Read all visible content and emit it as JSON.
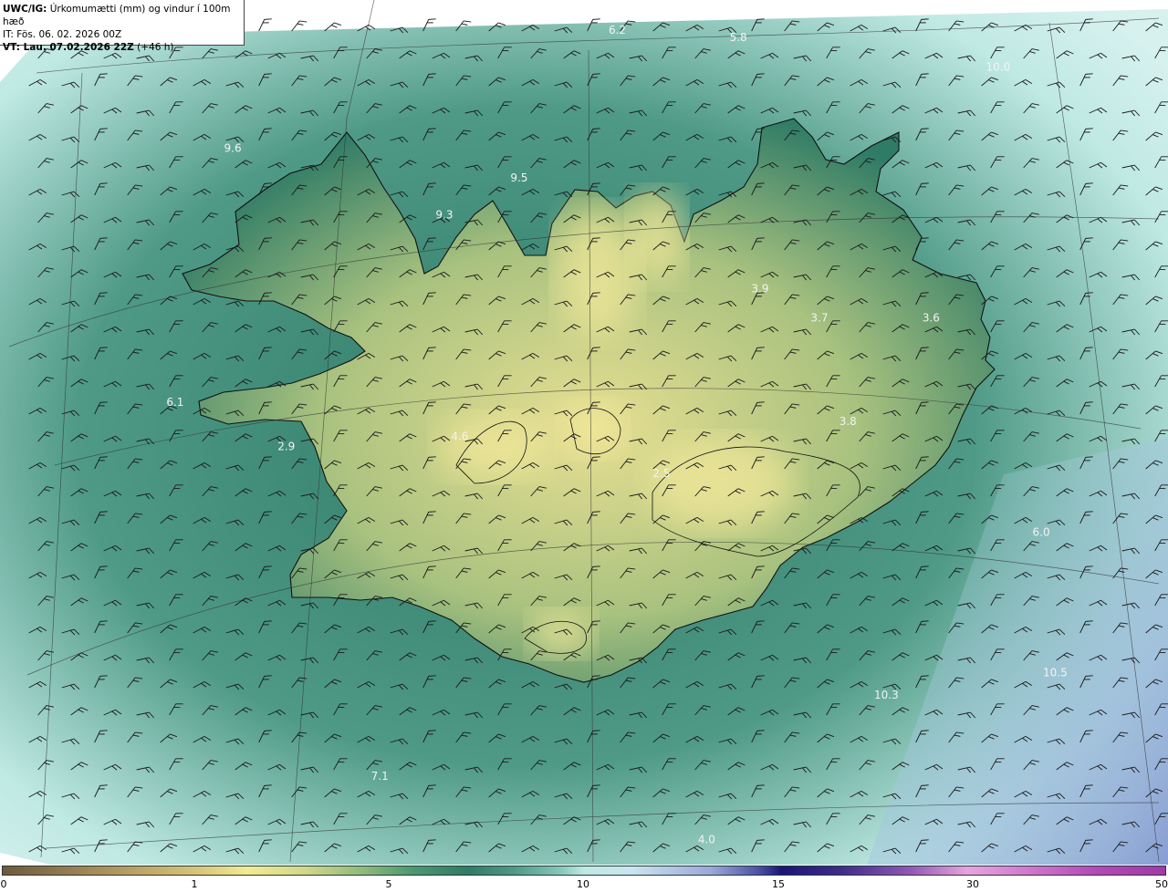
{
  "header": {
    "model_bold": "UWC/IG:",
    "title_rest": " Úrkomumætti (mm) og vindur í 100m hæð",
    "issue_time": "IT: Fös. 06. 02. 2026 00Z",
    "valid_time": "VT: Lau. 07.02.2026 22Z",
    "lead_time": " (+46 h)"
  },
  "map_labels": [
    {
      "text": "6.2",
      "lon": -18.05,
      "lat": 67.6
    },
    {
      "text": "5.8",
      "lon": -15.8,
      "lat": 67.55
    },
    {
      "text": "10.0",
      "lon": -11.0,
      "lat": 67.35
    },
    {
      "text": "9.6",
      "lon": -25.1,
      "lat": 66.8
    },
    {
      "text": "9.5",
      "lon": -19.85,
      "lat": 66.6
    },
    {
      "text": "9.3",
      "lon": -21.2,
      "lat": 66.35
    },
    {
      "text": "3.9",
      "lon": -15.5,
      "lat": 65.85
    },
    {
      "text": "3.7",
      "lon": -14.45,
      "lat": 65.65
    },
    {
      "text": "3.6",
      "lon": -12.45,
      "lat": 65.65
    },
    {
      "text": "6.1",
      "lon": -25.9,
      "lat": 65.08
    },
    {
      "text": "3.8",
      "lon": -14.0,
      "lat": 64.95
    },
    {
      "text": "2.9",
      "lon": -23.9,
      "lat": 64.78
    },
    {
      "text": "4.6",
      "lon": -20.85,
      "lat": 64.85
    },
    {
      "text": "2.5",
      "lon": -17.3,
      "lat": 64.6
    },
    {
      "text": "6.0",
      "lon": -10.7,
      "lat": 64.2
    },
    {
      "text": "10.5",
      "lon": -10.6,
      "lat": 63.25
    },
    {
      "text": "10.3",
      "lon": -13.5,
      "lat": 63.1
    },
    {
      "text": "7.1",
      "lon": -22.1,
      "lat": 62.55
    },
    {
      "text": "4.0",
      "lon": -16.6,
      "lat": 62.12
    }
  ],
  "legend": {
    "ticks": [
      {
        "label": "0",
        "value": 0
      },
      {
        "label": "1",
        "value": 1
      },
      {
        "label": "5",
        "value": 5
      },
      {
        "label": "10",
        "value": 10
      },
      {
        "label": "15",
        "value": 15
      },
      {
        "label": "30",
        "value": 30
      },
      {
        "label": "50",
        "value": 50
      }
    ]
  },
  "colors": {
    "sea_light": "#bfe9e3",
    "field_mid": "#4f9a86",
    "field_dark": "#2f7b66",
    "land_yellow": "#e7df92",
    "barb": "#1a1a1a",
    "coast": "#111111"
  }
}
